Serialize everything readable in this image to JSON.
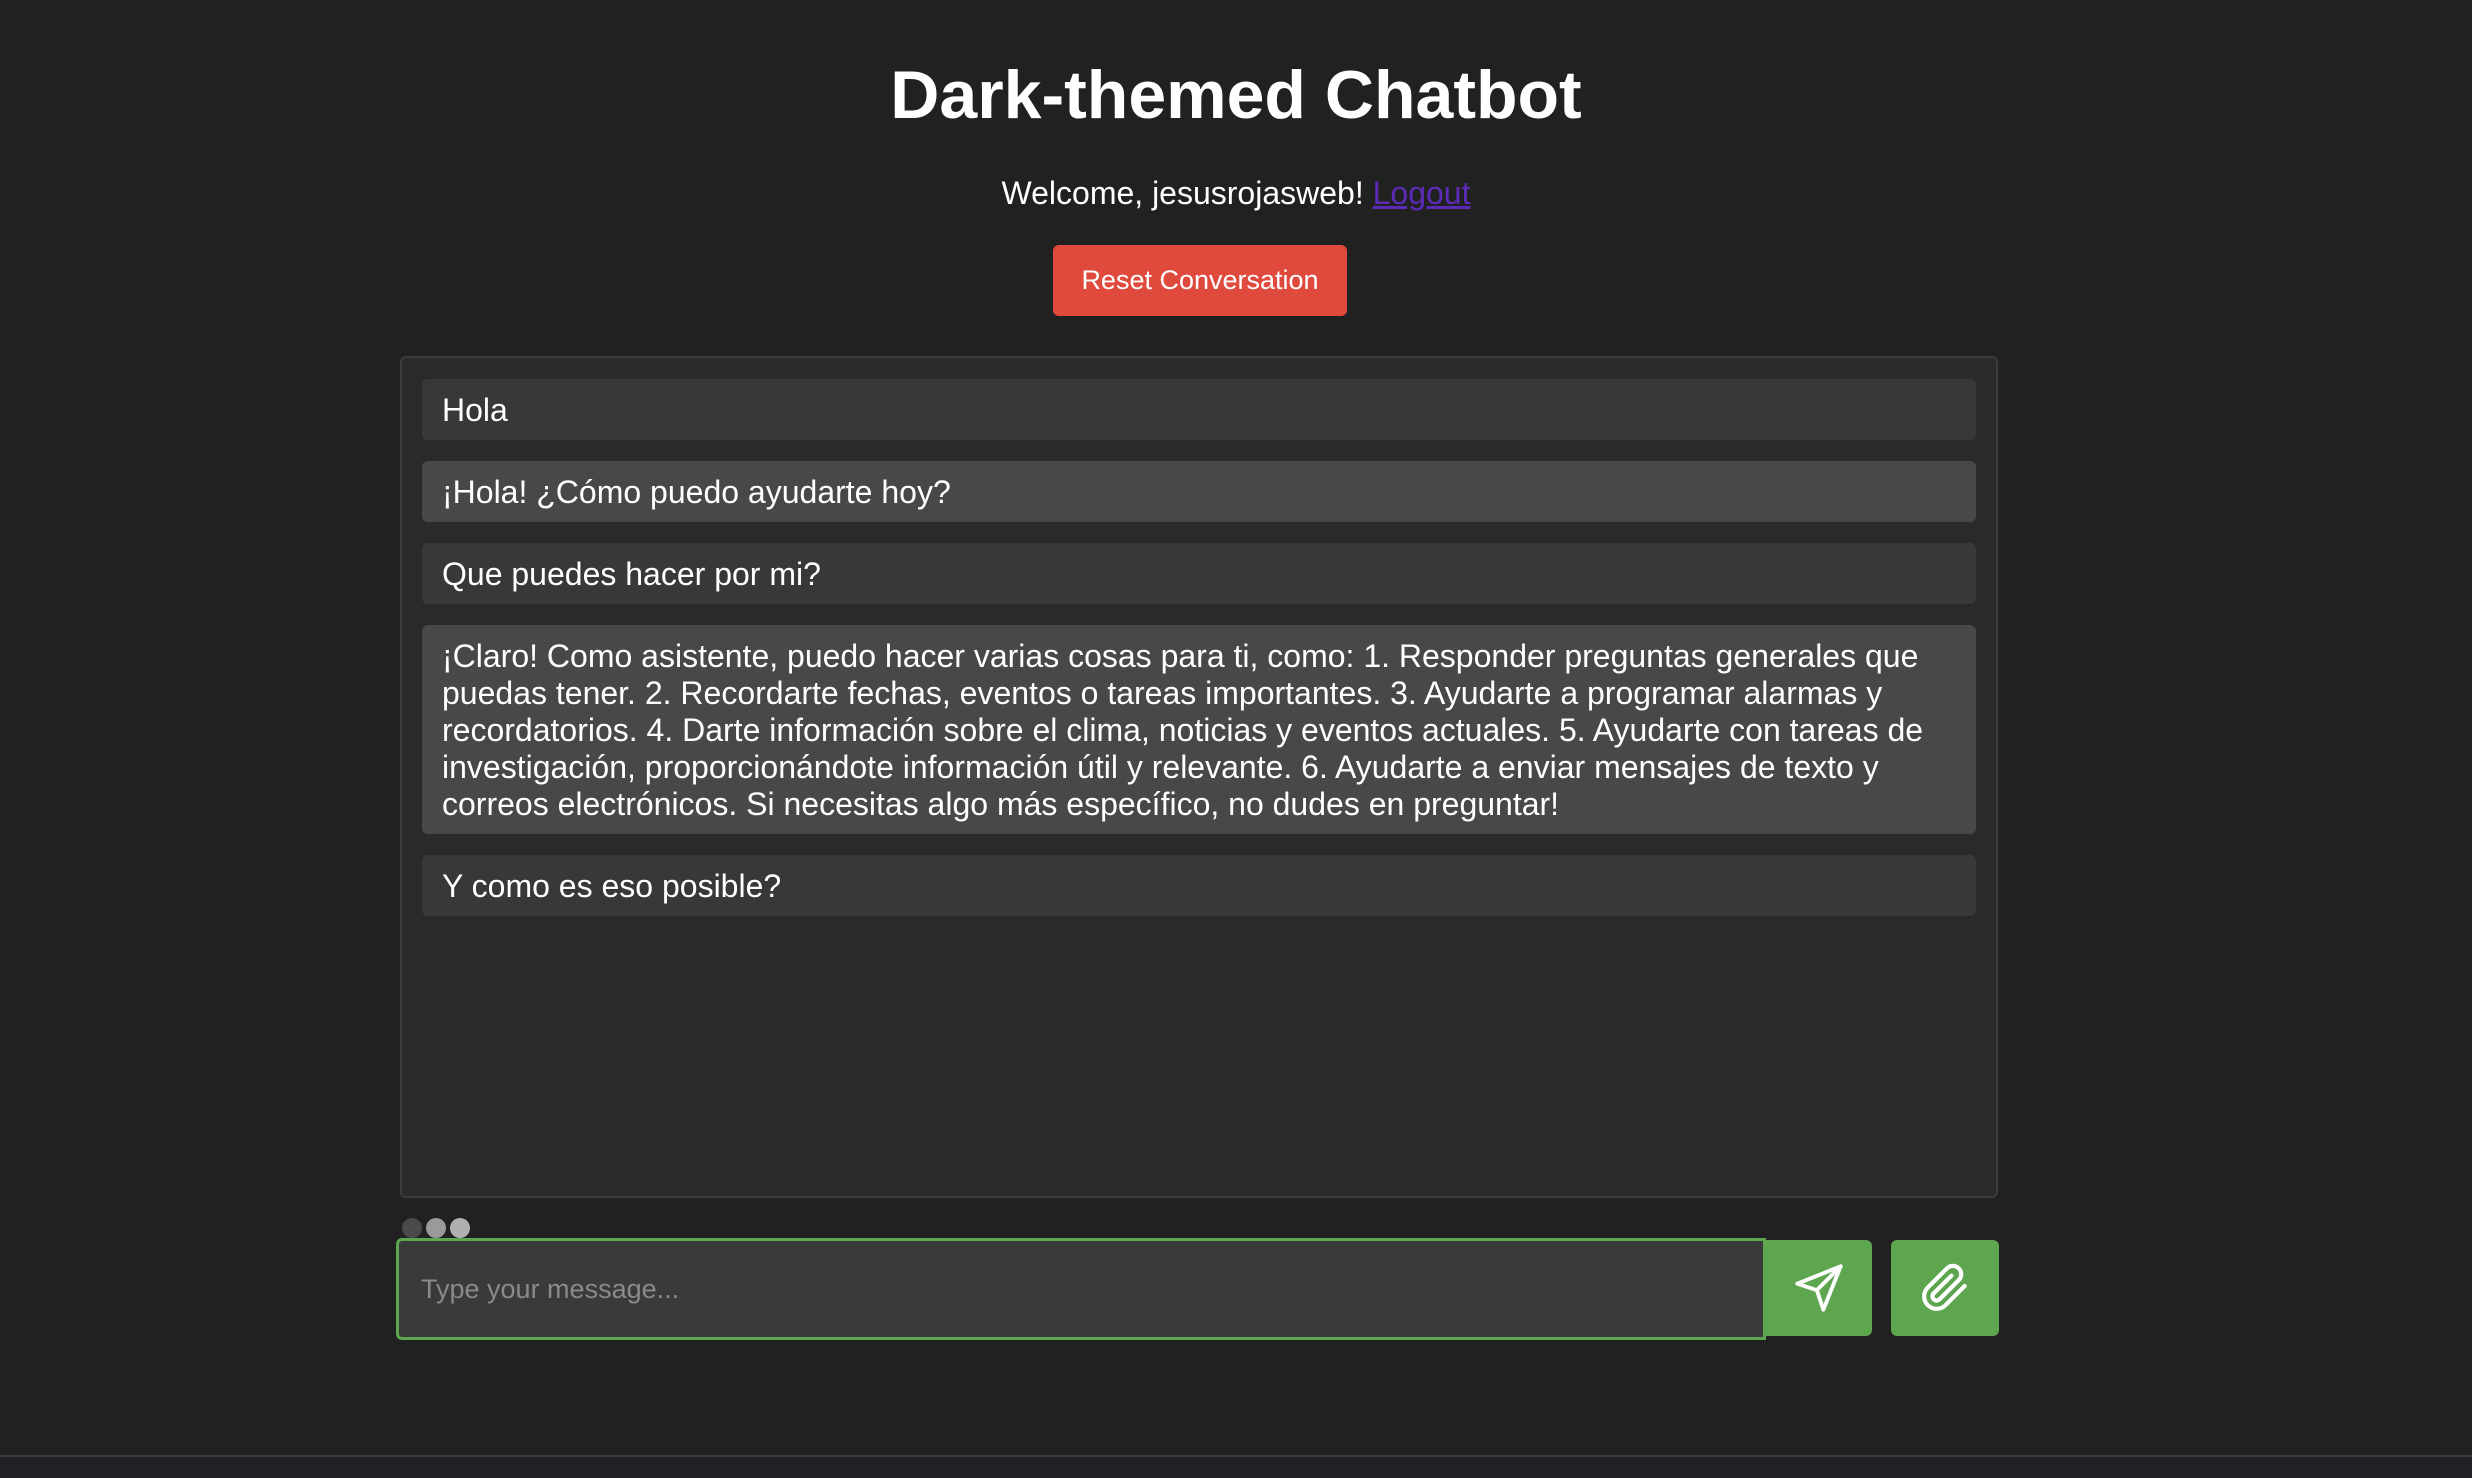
{
  "header": {
    "title": "Dark-themed Chatbot",
    "welcome_text": "Welcome, jesusrojasweb!",
    "logout_label": "Logout",
    "reset_label": "Reset Conversation"
  },
  "chat": {
    "messages": [
      {
        "role": "user",
        "text": "Hola"
      },
      {
        "role": "bot",
        "text": "¡Hola! ¿Cómo puedo ayudarte hoy?"
      },
      {
        "role": "user",
        "text": "Que puedes hacer por mi?"
      },
      {
        "role": "bot",
        "text": "¡Claro! Como asistente, puedo hacer varias cosas para ti, como: 1. Responder preguntas generales que puedas tener. 2. Recordarte fechas, eventos o tareas importantes. 3. Ayudarte a programar alarmas y recordatorios. 4. Darte información sobre el clima, noticias y eventos actuales. 5. Ayudarte con tareas de investigación, proporcionándote información útil y relevante. 6. Ayudarte a enviar mensajes de texto y correos electrónicos. Si necesitas algo más específico, no dudes en preguntar!"
      },
      {
        "role": "user",
        "text": "Y como es eso posible?"
      }
    ]
  },
  "composer": {
    "placeholder": "Type your message...",
    "send_icon": "send-icon",
    "attach_icon": "paperclip-icon"
  },
  "colors": {
    "background": "#212121",
    "chat_background": "#2a2a2a",
    "user_message": "#383838",
    "bot_message": "#484848",
    "reset_button": "#e04a3c",
    "accent_green": "#5da64f",
    "logout_link": "#5b2bb8"
  }
}
